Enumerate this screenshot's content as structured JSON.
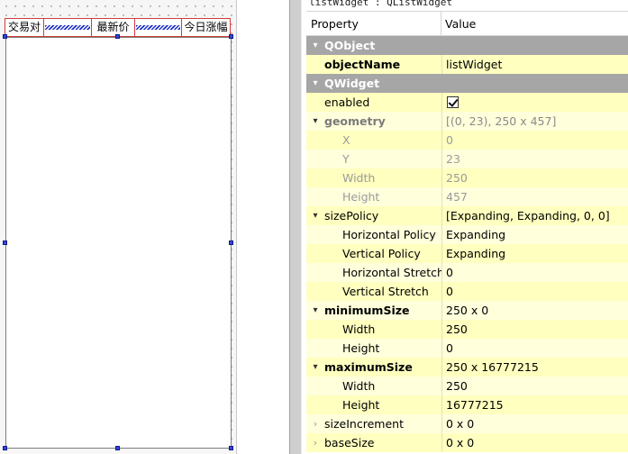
{
  "designer": {
    "header_labels": [
      "交易对",
      "最新价",
      "今日涨幅"
    ]
  },
  "property_editor": {
    "title": "listWidget : QListWidget",
    "col_property": "Property",
    "col_value": "Value",
    "rows": [
      {
        "kind": "cat",
        "name": "QObject",
        "expander": "▾"
      },
      {
        "kind": "prop",
        "name": "objectName",
        "value": "listWidget",
        "bold": true
      },
      {
        "kind": "cat",
        "name": "QWidget",
        "expander": "▾"
      },
      {
        "kind": "prop",
        "name": "enabled",
        "value": "",
        "checkbox": true
      },
      {
        "kind": "group",
        "name": "geometry",
        "value": "[(0, 23), 250 x 457]",
        "expander": "▾",
        "dim": true
      },
      {
        "kind": "sub",
        "name": "X",
        "value": "0",
        "dim": true
      },
      {
        "kind": "sub",
        "name": "Y",
        "value": "23",
        "dim": true
      },
      {
        "kind": "sub",
        "name": "Width",
        "value": "250",
        "dim": true
      },
      {
        "kind": "sub",
        "name": "Height",
        "value": "457",
        "dim": true
      },
      {
        "kind": "group",
        "name": "sizePolicy",
        "value": "[Expanding, Expanding, 0, 0]",
        "expander": "▾"
      },
      {
        "kind": "sub",
        "name": "Horizontal Policy",
        "value": "Expanding"
      },
      {
        "kind": "sub",
        "name": "Vertical Policy",
        "value": "Expanding"
      },
      {
        "kind": "sub",
        "name": "Horizontal Stretch",
        "value": "0"
      },
      {
        "kind": "sub",
        "name": "Vertical Stretch",
        "value": "0"
      },
      {
        "kind": "group",
        "name": "minimumSize",
        "value": "250 x 0",
        "expander": "▾",
        "bold": true
      },
      {
        "kind": "sub",
        "name": "Width",
        "value": "250"
      },
      {
        "kind": "sub",
        "name": "Height",
        "value": "0"
      },
      {
        "kind": "group",
        "name": "maximumSize",
        "value": "250 x 16777215",
        "expander": "▾",
        "bold": true
      },
      {
        "kind": "sub",
        "name": "Width",
        "value": "250"
      },
      {
        "kind": "sub",
        "name": "Height",
        "value": "16777215"
      },
      {
        "kind": "group",
        "name": "sizeIncrement",
        "value": "0 x 0",
        "expander": "›",
        "collapsed": true
      },
      {
        "kind": "group",
        "name": "baseSize",
        "value": "0 x 0",
        "expander": "›",
        "collapsed": true
      }
    ]
  }
}
